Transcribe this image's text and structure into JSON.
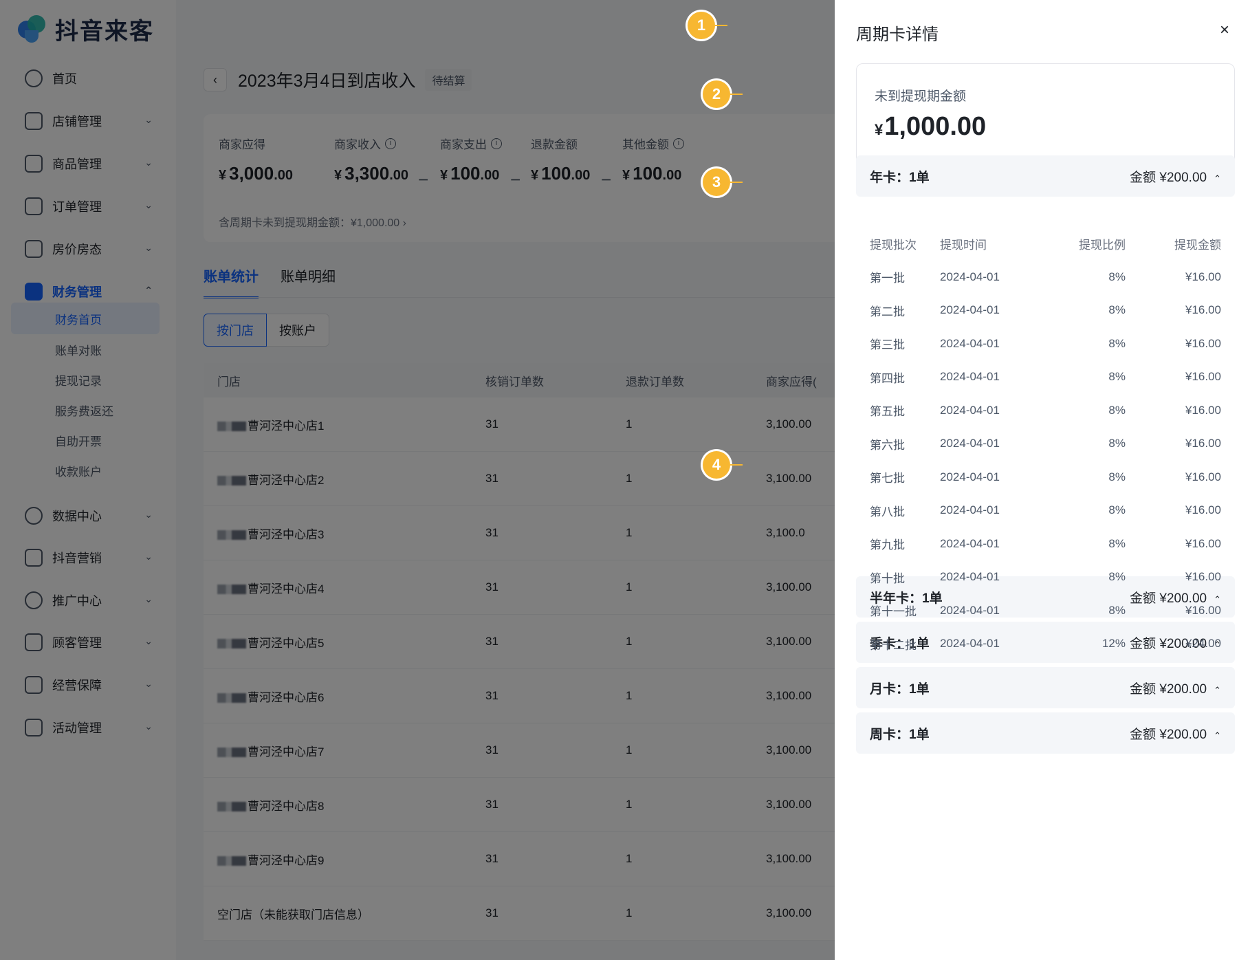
{
  "brand": {
    "name": "抖音来客"
  },
  "sidebar": {
    "items": [
      {
        "label": "首页",
        "icon": "home-icon",
        "has_chevron": false
      },
      {
        "label": "店铺管理",
        "icon": "store-icon",
        "has_chevron": true
      },
      {
        "label": "商品管理",
        "icon": "product-icon",
        "has_chevron": true
      },
      {
        "label": "订单管理",
        "icon": "order-icon",
        "has_chevron": true
      },
      {
        "label": "房价房态",
        "icon": "bed-icon",
        "has_chevron": true
      },
      {
        "label": "财务管理",
        "icon": "wallet-icon",
        "has_chevron": true,
        "active": true
      },
      {
        "label": "数据中心",
        "icon": "chart-icon",
        "has_chevron": true
      },
      {
        "label": "抖音营销",
        "icon": "megaphone-icon",
        "has_chevron": true
      },
      {
        "label": "推广中心",
        "icon": "location-icon",
        "has_chevron": true
      },
      {
        "label": "顾客管理",
        "icon": "user-icon",
        "has_chevron": true
      },
      {
        "label": "经营保障",
        "icon": "shield-icon",
        "has_chevron": true
      },
      {
        "label": "活动管理",
        "icon": "flag-icon",
        "has_chevron": true
      }
    ],
    "finance_sub": [
      "财务首页",
      "账单对账",
      "提现记录",
      "服务费返还",
      "自助开票",
      "收款账户"
    ]
  },
  "header": {
    "title": "2023年3月4日到店收入",
    "status": "待结算"
  },
  "summary": {
    "items": [
      {
        "label": "商家应得",
        "currency": "¥",
        "int": "3,000",
        "dec": ".00",
        "info": false
      },
      {
        "label": "商家收入",
        "currency": "¥",
        "int": "3,300",
        "dec": ".00",
        "info": true
      },
      {
        "label": "商家支出",
        "currency": "¥",
        "int": "100",
        "dec": ".00",
        "info": true
      },
      {
        "label": "退款金额",
        "currency": "¥",
        "int": "100",
        "dec": ".00",
        "info": false
      },
      {
        "label": "其他金额",
        "currency": "¥",
        "int": "100",
        "dec": ".00",
        "info": true
      }
    ],
    "operators": [
      "−",
      "−",
      "−"
    ],
    "note": "含周期卡未到提现期金额：¥1,000.00 ›"
  },
  "tabs": [
    "账单统计",
    "账单明细"
  ],
  "segments": [
    "按门店",
    "按账户"
  ],
  "table": {
    "headers": [
      "门店",
      "核销订单数",
      "退款订单数",
      "商家应得("
    ],
    "rows": [
      {
        "store": "曹河泾中心店1",
        "verified": "31",
        "refund": "1",
        "due": "3,100.00",
        "masked": true
      },
      {
        "store": "曹河泾中心店2",
        "verified": "31",
        "refund": "1",
        "due": "3,100.00",
        "masked": true
      },
      {
        "store": "曹河泾中心店3",
        "verified": "31",
        "refund": "1",
        "due": "3,100.0",
        "masked": true
      },
      {
        "store": "曹河泾中心店4",
        "verified": "31",
        "refund": "1",
        "due": "3,100.00",
        "masked": true
      },
      {
        "store": "曹河泾中心店5",
        "verified": "31",
        "refund": "1",
        "due": "3,100.00",
        "masked": true
      },
      {
        "store": "曹河泾中心店6",
        "verified": "31",
        "refund": "1",
        "due": "3,100.00",
        "masked": true
      },
      {
        "store": "曹河泾中心店7",
        "verified": "31",
        "refund": "1",
        "due": "3,100.00",
        "masked": true
      },
      {
        "store": "曹河泾中心店8",
        "verified": "31",
        "refund": "1",
        "due": "3,100.00",
        "masked": true
      },
      {
        "store": "曹河泾中心店9",
        "verified": "31",
        "refund": "1",
        "due": "3,100.00",
        "masked": true
      },
      {
        "store": "空门店（未能获取门店信息）",
        "verified": "31",
        "refund": "1",
        "due": "3,100.00",
        "masked": false
      }
    ]
  },
  "drawer": {
    "title": "周期卡详情",
    "close": "×",
    "pending": {
      "label": "未到提现期金额",
      "currency": "¥",
      "value": "1,000.00"
    },
    "groups": [
      {
        "title": "年卡：1单",
        "amount": "金额 ¥200.00",
        "expanded": true
      },
      {
        "title": "半年卡：1单",
        "amount": "金额 ¥200.00",
        "expanded": false
      },
      {
        "title": "季卡：1单",
        "amount": "金额 ¥200.00",
        "expanded": false
      },
      {
        "title": "月卡：1单",
        "amount": "金额 ¥200.00",
        "expanded": false
      },
      {
        "title": "周卡：1单",
        "amount": "金额 ¥200.00",
        "expanded": false
      }
    ],
    "batch_headers": [
      "提现批次",
      "提现时间",
      "提现比例",
      "提现金额"
    ],
    "batches": [
      [
        "第一批",
        "2024-04-01",
        "8%",
        "¥16.00"
      ],
      [
        "第二批",
        "2024-04-01",
        "8%",
        "¥16.00"
      ],
      [
        "第三批",
        "2024-04-01",
        "8%",
        "¥16.00"
      ],
      [
        "第四批",
        "2024-04-01",
        "8%",
        "¥16.00"
      ],
      [
        "第五批",
        "2024-04-01",
        "8%",
        "¥16.00"
      ],
      [
        "第六批",
        "2024-04-01",
        "8%",
        "¥16.00"
      ],
      [
        "第七批",
        "2024-04-01",
        "8%",
        "¥16.00"
      ],
      [
        "第八批",
        "2024-04-01",
        "8%",
        "¥16.00"
      ],
      [
        "第九批",
        "2024-04-01",
        "8%",
        "¥16.00"
      ],
      [
        "第十批",
        "2024-04-01",
        "8%",
        "¥16.00"
      ],
      [
        "第十一批",
        "2024-04-01",
        "8%",
        "¥16.00"
      ],
      [
        "第十二批",
        "2024-04-01",
        "12%",
        "¥24.00"
      ]
    ]
  },
  "callouts": [
    "1",
    "2",
    "3",
    "4"
  ],
  "colors": {
    "accent": "#1664ff",
    "callout": "#f7b731"
  }
}
